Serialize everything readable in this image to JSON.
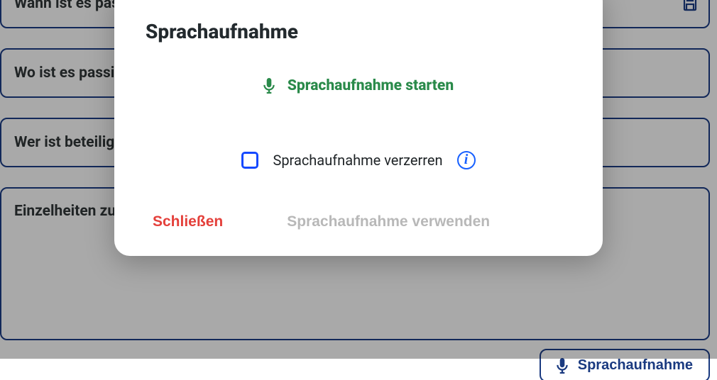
{
  "fields": {
    "when": "Wann ist es passiert?",
    "where": "Wo ist es passiert?",
    "who": "Wer ist beteiligt?",
    "details": "Einzelheiten zum Vorfall"
  },
  "voice_button": "Sprachaufnahme",
  "modal": {
    "title": "Sprachaufnahme",
    "start": "Sprachaufnahme starten",
    "distort": "Sprachaufnahme verzerren",
    "close": "Schließen",
    "use": "Sprachaufnahme verwenden"
  }
}
